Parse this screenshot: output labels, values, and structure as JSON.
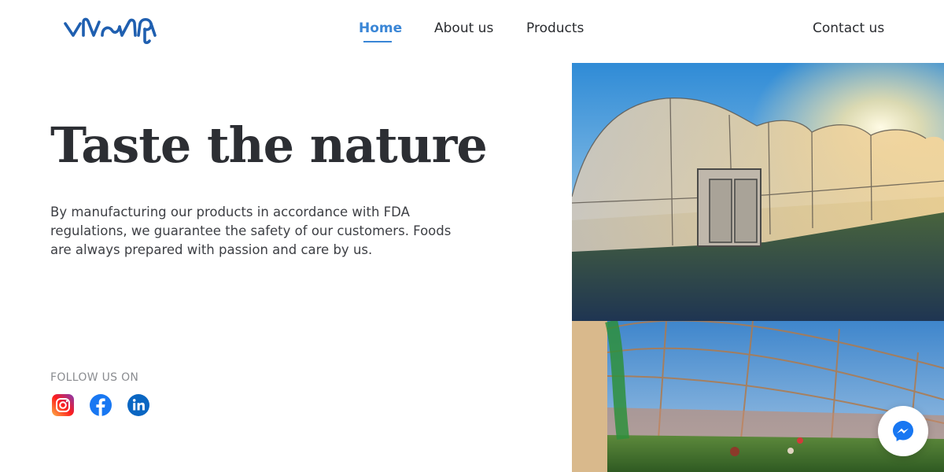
{
  "header": {
    "logo_text": "vloilp",
    "nav": {
      "home": "Home",
      "about": "About us",
      "products": "Products",
      "contact": "Contact us"
    }
  },
  "hero": {
    "title": "Taste the nature",
    "description": "By manufacturing our products in accordance with FDA regulations, we guarantee the safety of our customers. Foods are always prepared with passion and care by us."
  },
  "social": {
    "label": "FOLLOW US ON",
    "icons": [
      "instagram-icon",
      "facebook-icon",
      "linkedin-icon"
    ]
  },
  "colors": {
    "accent": "#3a86d6",
    "logo": "#1f5fb0",
    "title": "#2c2e33"
  }
}
